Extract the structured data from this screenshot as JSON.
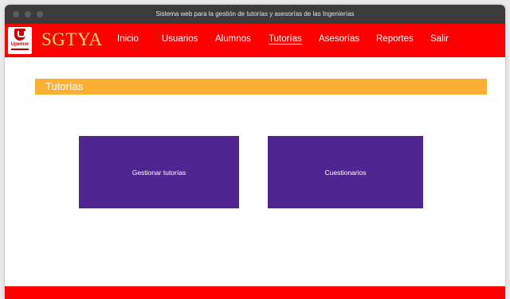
{
  "window": {
    "title": "Sistema web para la gestión de tutorías y asesorías de las Ingenierías"
  },
  "brand": {
    "logo_text": "Upemor",
    "name": "SGTYA"
  },
  "nav": {
    "items": [
      {
        "label": "Inicio"
      },
      {
        "label": "Usuarios"
      },
      {
        "label": "Alumnos"
      },
      {
        "label": "Tutorías",
        "active": true
      },
      {
        "label": "Asesorías"
      },
      {
        "label": "Reportes"
      },
      {
        "label": "Salir"
      }
    ]
  },
  "section": {
    "title": "Tutorías"
  },
  "tiles": [
    {
      "label": "Gestionar tutorías"
    },
    {
      "label": "Cuestionarios"
    }
  ],
  "colors": {
    "nav_bg": "#ff0000",
    "brand_text": "#ffd966",
    "section_header_bg": "#fbb034",
    "tile_bg": "#502491",
    "footer_bg": "#ff0000"
  }
}
